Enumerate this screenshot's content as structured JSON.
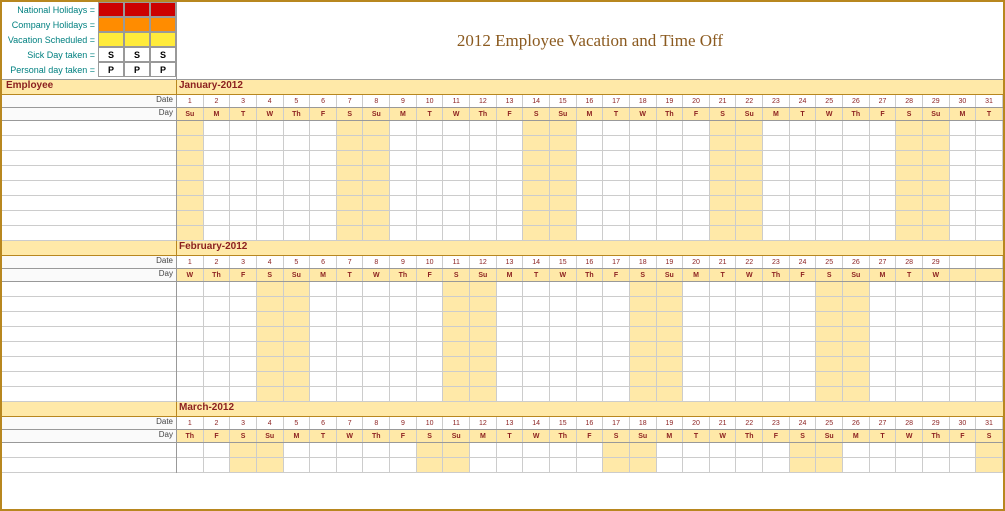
{
  "title": "2012 Employee Vacation and Time Off",
  "legend": {
    "national": {
      "label": "National Holidays =",
      "colors": [
        "#cc0000",
        "#cc0000",
        "#cc0000"
      ]
    },
    "company": {
      "label": "Company Holidays =",
      "colors": [
        "#ff8c00",
        "#ff8c00",
        "#ff8c00"
      ]
    },
    "vacation": {
      "label": "Vacation Scheduled =",
      "colors": [
        "#ffeb3b",
        "#ffeb3b",
        "#ffeb3b"
      ]
    },
    "sick": {
      "label": "Sick Day taken =",
      "vals": [
        "S",
        "S",
        "S"
      ]
    },
    "personal": {
      "label": "Personal day taken =",
      "vals": [
        "P",
        "P",
        "P"
      ]
    }
  },
  "emp_header": "Employee",
  "date_label": "Date",
  "day_label": "Day",
  "months": [
    {
      "name": "January-2012",
      "dates": [
        "1",
        "2",
        "3",
        "4",
        "5",
        "6",
        "7",
        "8",
        "9",
        "10",
        "11",
        "12",
        "13",
        "14",
        "15",
        "16",
        "17",
        "18",
        "19",
        "20",
        "21",
        "22",
        "23",
        "24",
        "25",
        "26",
        "27",
        "28",
        "29",
        "30",
        "31"
      ],
      "days": [
        "Su",
        "M",
        "T",
        "W",
        "Th",
        "F",
        "S",
        "Su",
        "M",
        "T",
        "W",
        "Th",
        "F",
        "S",
        "Su",
        "M",
        "T",
        "W",
        "Th",
        "F",
        "S",
        "Su",
        "M",
        "T",
        "W",
        "Th",
        "F",
        "S",
        "Su",
        "M",
        "T"
      ],
      "rows": 8
    },
    {
      "name": "February-2012",
      "dates": [
        "1",
        "2",
        "3",
        "4",
        "5",
        "6",
        "7",
        "8",
        "9",
        "10",
        "11",
        "12",
        "13",
        "14",
        "15",
        "16",
        "17",
        "18",
        "19",
        "20",
        "21",
        "22",
        "23",
        "24",
        "25",
        "26",
        "27",
        "28",
        "29",
        "",
        ""
      ],
      "days": [
        "W",
        "Th",
        "F",
        "S",
        "Su",
        "M",
        "T",
        "W",
        "Th",
        "F",
        "S",
        "Su",
        "M",
        "T",
        "W",
        "Th",
        "F",
        "S",
        "Su",
        "M",
        "T",
        "W",
        "Th",
        "F",
        "S",
        "Su",
        "M",
        "T",
        "W",
        "",
        ""
      ],
      "rows": 8
    },
    {
      "name": "March-2012",
      "dates": [
        "1",
        "2",
        "3",
        "4",
        "5",
        "6",
        "7",
        "8",
        "9",
        "10",
        "11",
        "12",
        "13",
        "14",
        "15",
        "16",
        "17",
        "18",
        "19",
        "20",
        "21",
        "22",
        "23",
        "24",
        "25",
        "26",
        "27",
        "28",
        "29",
        "30",
        "31"
      ],
      "days": [
        "Th",
        "F",
        "S",
        "Su",
        "M",
        "T",
        "W",
        "Th",
        "F",
        "S",
        "Su",
        "M",
        "T",
        "W",
        "Th",
        "F",
        "S",
        "Su",
        "M",
        "T",
        "W",
        "Th",
        "F",
        "S",
        "Su",
        "M",
        "T",
        "W",
        "Th",
        "F",
        "S"
      ],
      "rows": 2
    }
  ]
}
